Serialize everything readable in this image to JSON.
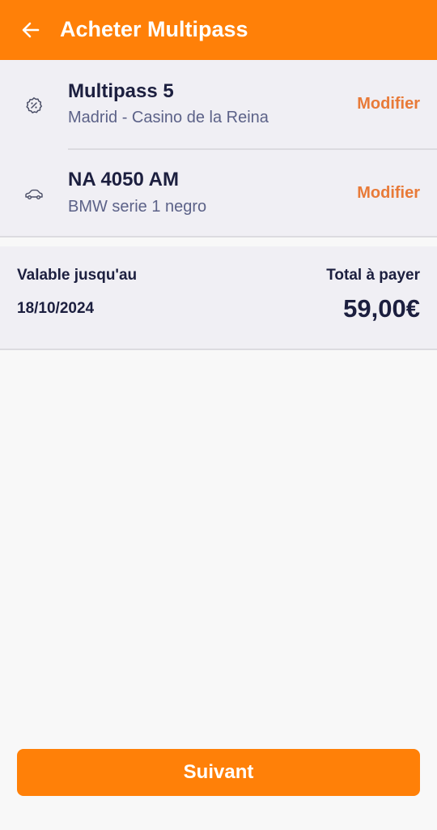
{
  "header": {
    "title": "Acheter Multipass",
    "back_icon": "arrow-left-icon"
  },
  "items": [
    {
      "icon": "discount-badge-icon",
      "title": "Multipass 5",
      "subtitle": "Madrid - Casino de la Reina",
      "action": "Modifier"
    },
    {
      "icon": "car-icon",
      "title": "NA 4050 AM",
      "subtitle": "BMW serie 1 negro",
      "action": "Modifier"
    }
  ],
  "summary": {
    "valid_label": "Valable jusqu'au",
    "valid_date": "18/10/2024",
    "total_label": "Total à payer",
    "total_value": "59,00€"
  },
  "footer": {
    "next_label": "Suivant"
  },
  "colors": {
    "primary": "#ff8008",
    "accent_text": "#e87a38",
    "dark_text": "#1c1f3f",
    "muted_text": "#5c6288",
    "card_bg": "#f0eff4"
  }
}
